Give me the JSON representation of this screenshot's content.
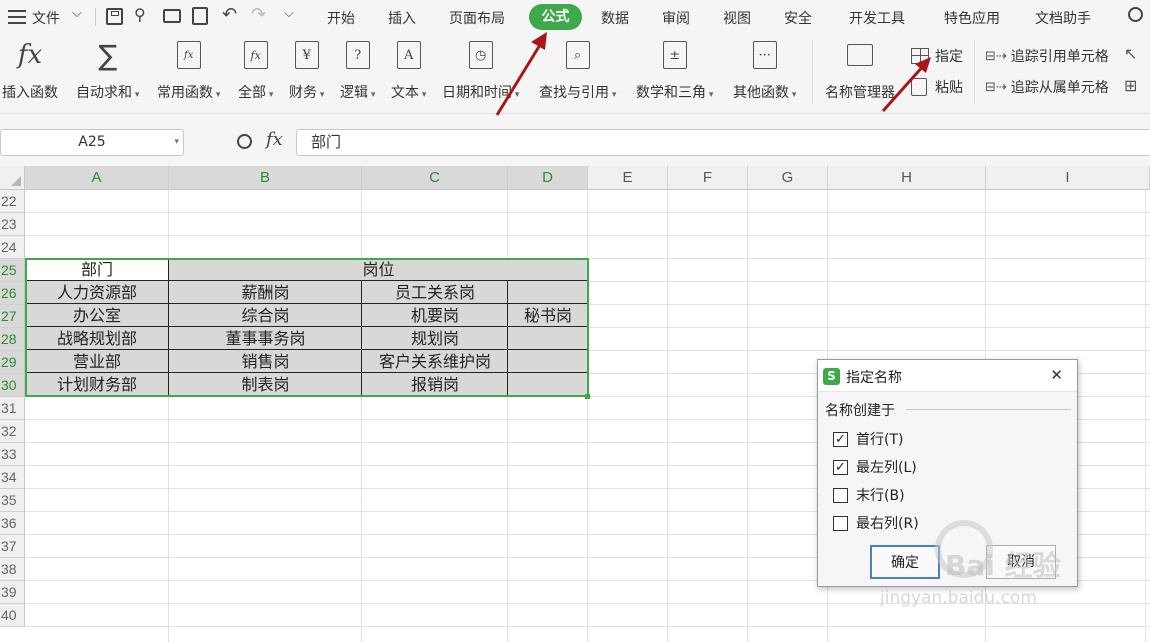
{
  "menubar": {
    "file_label": "文件",
    "tabs": [
      "开始",
      "插入",
      "页面布局",
      "公式",
      "数据",
      "审阅",
      "视图",
      "安全",
      "开发工具",
      "特色应用",
      "文档助手"
    ],
    "active_tab": "公式"
  },
  "ribbon": {
    "insert_function": "插入函数",
    "autosum": "自动求和",
    "common_functions": "常用函数",
    "all": "全部",
    "finance": "财务",
    "logic": "逻辑",
    "text": "文本",
    "datetime": "日期和时间",
    "lookup": "查找与引用",
    "math": "数学和三角",
    "other": "其他函数",
    "name_manager": "名称管理器",
    "specify": "指定",
    "paste": "粘贴",
    "trace_precedents": "追踪引用单元格",
    "trace_dependents": "追踪从属单元格",
    "fx_symbol": "fx",
    "sum_symbol": "∑",
    "finance_glyph": "¥",
    "logic_glyph": "?",
    "text_glyph": "A",
    "datetime_glyph": "◷",
    "lookup_glyph": "⌕",
    "math_glyph": "±",
    "other_glyph": "···"
  },
  "formula_bar": {
    "name_box": "A25",
    "fx_symbol": "fx",
    "value": "部门"
  },
  "grid": {
    "columns": [
      "A",
      "B",
      "C",
      "D",
      "E",
      "F",
      "G",
      "H",
      "I"
    ],
    "rows": [
      "22",
      "23",
      "24",
      "25",
      "26",
      "27",
      "28",
      "29",
      "30",
      "31",
      "32",
      "33",
      "34",
      "35",
      "36",
      "37",
      "38",
      "39",
      "40"
    ],
    "selected_columns": [
      "A",
      "B",
      "C",
      "D"
    ],
    "selected_rows": [
      "25",
      "26",
      "27",
      "28",
      "29",
      "30"
    ]
  },
  "table": {
    "header_dept": "部门",
    "header_position": "岗位",
    "rows": [
      {
        "dept": "人力资源部",
        "b": "薪酬岗",
        "c": "员工关系岗",
        "d": ""
      },
      {
        "dept": "办公室",
        "b": "综合岗",
        "c": "机要岗",
        "d": "秘书岗"
      },
      {
        "dept": "战略规划部",
        "b": "董事事务岗",
        "c": "规划岗",
        "d": ""
      },
      {
        "dept": "营业部",
        "b": "销售岗",
        "c": "客户关系维护岗",
        "d": ""
      },
      {
        "dept": "计划财务部",
        "b": "制表岗",
        "c": "报销岗",
        "d": ""
      }
    ]
  },
  "dialog": {
    "title": "指定名称",
    "icon_letter": "S",
    "close_symbol": "✕",
    "group_label": "名称创建于",
    "options": [
      {
        "label": "首行(T)",
        "checked": true
      },
      {
        "label": "最左列(L)",
        "checked": true
      },
      {
        "label": "末行(B)",
        "checked": false
      },
      {
        "label": "最右列(R)",
        "checked": false
      }
    ],
    "ok": "确定",
    "cancel": "取消"
  },
  "watermark": {
    "brand": "Bai 经验",
    "url": "jingyan.baidu.com"
  },
  "colors": {
    "accent_green": "#3ea84a",
    "annotation_red": "#a8161a",
    "table_fill": "#d8d8d8"
  }
}
